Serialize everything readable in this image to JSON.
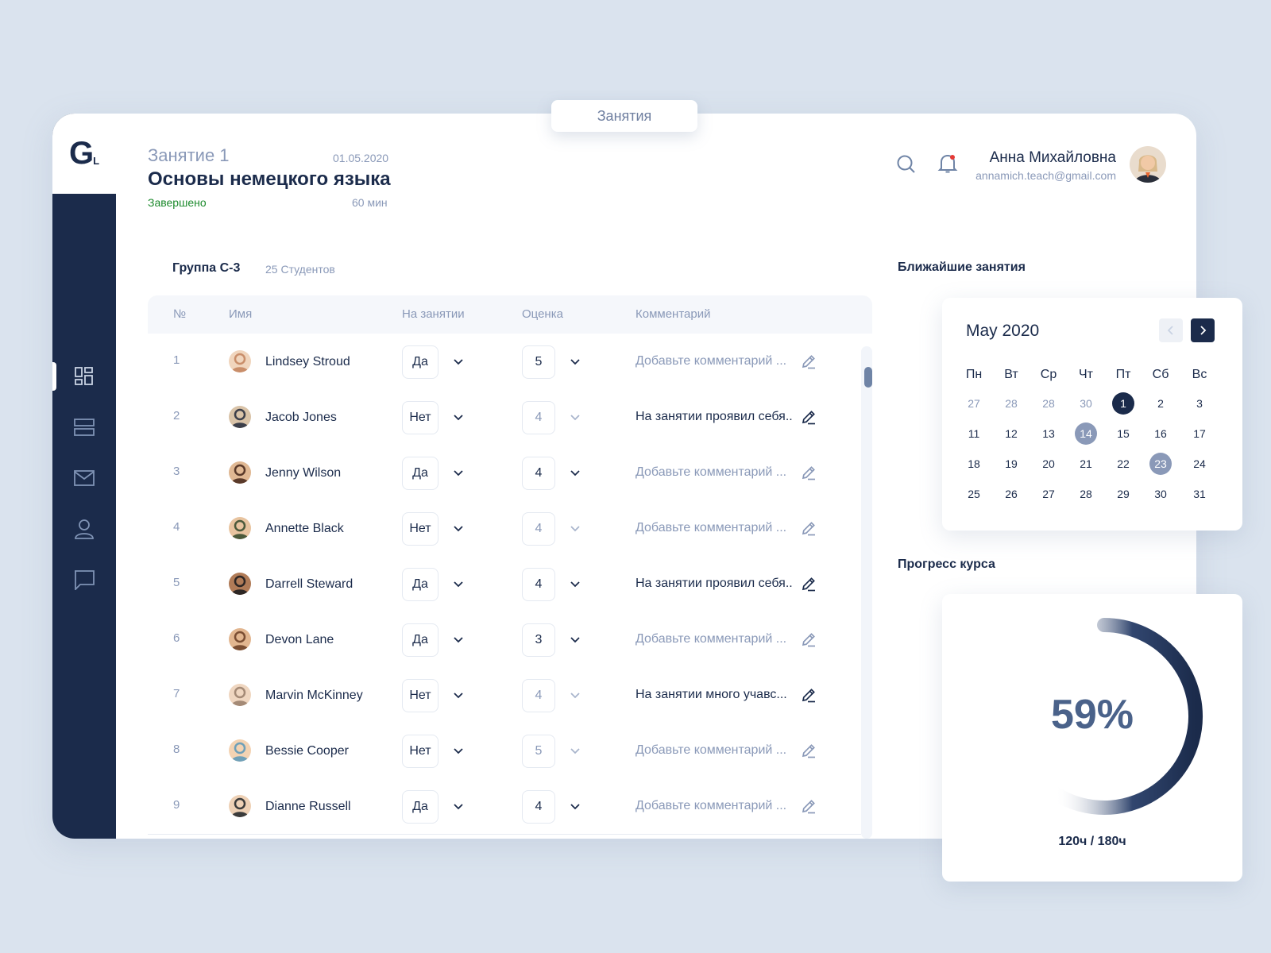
{
  "tab": {
    "label": "Занятия"
  },
  "logo": {
    "main": "G",
    "sub": "L"
  },
  "sidebar": {
    "items": [
      {
        "icon": "dashboard-icon",
        "active": true
      },
      {
        "icon": "list-icon",
        "active": false
      },
      {
        "icon": "mail-icon",
        "active": false
      },
      {
        "icon": "user-icon",
        "active": false
      },
      {
        "icon": "chat-icon",
        "active": false
      }
    ]
  },
  "lesson": {
    "number": "Занятие 1",
    "date": "01.05.2020",
    "title": "Основы немецкого языка",
    "status": "Завершено",
    "duration": "60 мин"
  },
  "user": {
    "name": "Анна Михайловна",
    "email": "annamich.teach@gmail.com"
  },
  "group": {
    "name": "Группа С-3",
    "count": "25 Студентов"
  },
  "table": {
    "headers": {
      "num": "№",
      "name": "Имя",
      "attendance": "На занятии",
      "grade": "Оценка",
      "comment": "Комментарий"
    },
    "rows": [
      {
        "num": "1",
        "name": "Lindsey Stroud",
        "attendance": "Да",
        "grade": "5",
        "comment": "Добавьте комментарий ...",
        "placeholder": true
      },
      {
        "num": "2",
        "name": "Jacob Jones",
        "attendance": "Нет",
        "grade": "4",
        "comment": "На занятии проявил себя..",
        "placeholder": false
      },
      {
        "num": "3",
        "name": "Jenny Wilson",
        "attendance": "Да",
        "grade": "4",
        "comment": "Добавьте комментарий ...",
        "placeholder": true
      },
      {
        "num": "4",
        "name": "Annette Black",
        "attendance": "Нет",
        "grade": "4",
        "comment": "Добавьте комментарий ...",
        "placeholder": true
      },
      {
        "num": "5",
        "name": "Darrell Steward",
        "attendance": "Да",
        "grade": "4",
        "comment": "На занятии проявил себя..",
        "placeholder": false
      },
      {
        "num": "6",
        "name": "Devon Lane",
        "attendance": "Да",
        "grade": "3",
        "comment": "Добавьте комментарий ...",
        "placeholder": true
      },
      {
        "num": "7",
        "name": "Marvin McKinney",
        "attendance": "Нет",
        "grade": "4",
        "comment": "На занятии много учавс...",
        "placeholder": false
      },
      {
        "num": "8",
        "name": "Bessie Cooper",
        "attendance": "Нет",
        "grade": "5",
        "comment": "Добавьте комментарий ...",
        "placeholder": true
      },
      {
        "num": "9",
        "name": "Dianne Russell",
        "attendance": "Да",
        "grade": "4",
        "comment": "Добавьте комментарий ...",
        "placeholder": true
      }
    ]
  },
  "upcoming": {
    "title": "Ближайшие занятия",
    "month": "May 2020",
    "weekdays": [
      "Пн",
      "Вт",
      "Ср",
      "Чт",
      "Пт",
      "Сб",
      "Вс"
    ],
    "weeks": [
      [
        {
          "d": "27",
          "t": "muted"
        },
        {
          "d": "28",
          "t": "muted"
        },
        {
          "d": "28",
          "t": "muted"
        },
        {
          "d": "30",
          "t": "muted"
        },
        {
          "d": "1",
          "t": "today"
        },
        {
          "d": "2",
          "t": ""
        },
        {
          "d": "3",
          "t": ""
        }
      ],
      [
        {
          "d": "11",
          "t": ""
        },
        {
          "d": "12",
          "t": ""
        },
        {
          "d": "13",
          "t": ""
        },
        {
          "d": "14",
          "t": "mark"
        },
        {
          "d": "15",
          "t": ""
        },
        {
          "d": "16",
          "t": ""
        },
        {
          "d": "17",
          "t": ""
        }
      ],
      [
        {
          "d": "18",
          "t": ""
        },
        {
          "d": "19",
          "t": ""
        },
        {
          "d": "20",
          "t": ""
        },
        {
          "d": "21",
          "t": ""
        },
        {
          "d": "22",
          "t": ""
        },
        {
          "d": "23",
          "t": "mark"
        },
        {
          "d": "24",
          "t": ""
        }
      ],
      [
        {
          "d": "25",
          "t": ""
        },
        {
          "d": "26",
          "t": ""
        },
        {
          "d": "27",
          "t": ""
        },
        {
          "d": "28",
          "t": ""
        },
        {
          "d": "29",
          "t": ""
        },
        {
          "d": "30",
          "t": ""
        },
        {
          "d": "31",
          "t": ""
        }
      ]
    ]
  },
  "progress": {
    "title": "Прогресс курса",
    "percent_label": "59%",
    "value": 0.59,
    "hours": "120ч / 180ч"
  },
  "colors": {
    "navy": "#1b2b4b",
    "muted": "#8a99b8",
    "green": "#1c8a2c",
    "bg": "#dae3ee"
  }
}
